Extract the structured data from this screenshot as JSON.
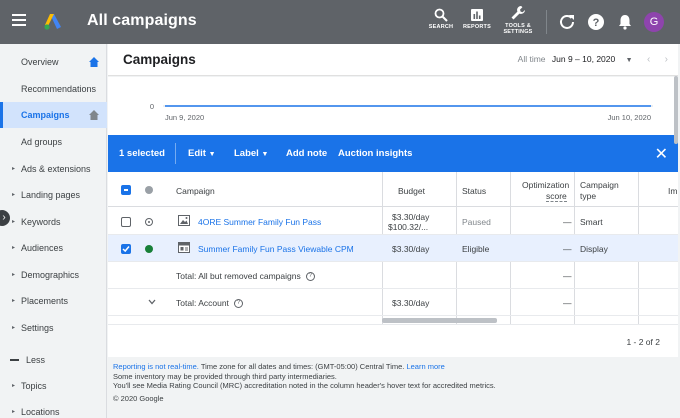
{
  "header": {
    "title": "All campaigns",
    "menu_icon": "hamburger-menu-icon",
    "logo_icon": "google-ads-logo-icon",
    "tools": [
      {
        "label": "SEARCH",
        "icon": "search-icon"
      },
      {
        "label": "REPORTS",
        "icon": "reports-icon"
      },
      {
        "label_line1": "TOOLS &",
        "label_line2": "SETTINGS",
        "icon": "wrench-icon"
      }
    ],
    "avatar_letter": "G",
    "colors": {
      "bar": "#5f6368",
      "avatar": "#8e44ad"
    }
  },
  "sidebar": {
    "items": [
      {
        "label": "Overview"
      },
      {
        "label": "Recommendations"
      },
      {
        "label": "Campaigns"
      },
      {
        "label": "Ad groups"
      },
      {
        "label": "Ads & extensions"
      },
      {
        "label": "Landing pages"
      },
      {
        "label": "Keywords"
      },
      {
        "label": "Audiences"
      },
      {
        "label": "Demographics"
      },
      {
        "label": "Placements"
      },
      {
        "label": "Settings"
      },
      {
        "label": "Less"
      },
      {
        "label": "Topics"
      },
      {
        "label": "Locations"
      }
    ],
    "active": "Campaigns"
  },
  "page": {
    "title": "Campaigns",
    "date_prefix": "All time",
    "date_range": "Jun 9 – 10, 2020"
  },
  "chart_data": {
    "type": "line",
    "y_tick": "0",
    "x": [
      "Jun 9, 2020",
      "Jun 10, 2020"
    ],
    "series": [
      {
        "values": [
          0,
          0
        ]
      }
    ],
    "color": "#1a73e8"
  },
  "selection_bar": {
    "count_label": "1 selected",
    "edit": "Edit",
    "label": "Label",
    "add_note": "Add note",
    "auction": "Auction insights",
    "color": "#1a73e8"
  },
  "table": {
    "headers": {
      "campaign": "Campaign",
      "budget": "Budget",
      "status": "Status",
      "opt_line1": "Optimization",
      "opt_line2": "score",
      "type_line1": "Campaign",
      "type_line2": "type",
      "cut": "Im"
    },
    "rows": [
      {
        "name": "4ORE Summer Family Fun Pass",
        "budget_line1": "$3.30/day",
        "budget_line2": "$100.32/...",
        "status": "Paused",
        "opt": "—",
        "type": "Smart",
        "checked": false
      },
      {
        "name": "Summer Family Fun Pass Viewable CPM",
        "budget_line1": "$3.30/day",
        "status": "Eligible",
        "opt": "—",
        "type": "Display",
        "checked": true
      }
    ],
    "totals": [
      {
        "label": "Total: All but removed campaigns",
        "opt": "—"
      },
      {
        "label": "Total: Account",
        "budget": "$3.30/day",
        "opt": "—"
      }
    ]
  },
  "pager": {
    "text": "1 - 2 of 2"
  },
  "footer": {
    "realtime_link": "Reporting is not real-time.",
    "tz_text": " Time zone for all dates and times: (GMT-05:00) Central Time.",
    "learn_more": "Learn more",
    "line2": "Some inventory may be provided through third party intermediaries.",
    "line3": "You'll see Media Rating Council (MRC) accreditation noted in the column header's hover text for accredited metrics.",
    "line4": "© 2020 Google"
  }
}
